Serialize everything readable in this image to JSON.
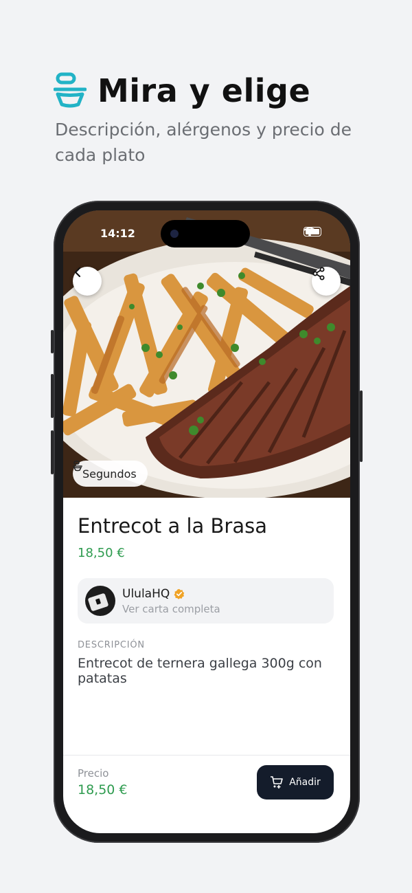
{
  "promo": {
    "title": "Mira y elige",
    "subtitle": "Descripción, alérgenos y precio de cada plato",
    "icon": "bowl-icon",
    "accent_color": "#22b3c6"
  },
  "status_bar": {
    "time": "14:12"
  },
  "hero": {
    "image_subject": "steak-with-fries-photo"
  },
  "category": {
    "label": "Segundos",
    "icon": "bowl-icon"
  },
  "dish": {
    "name": "Entrecot a la Brasa",
    "price": "18,50 €"
  },
  "vendor": {
    "name": "UlulaHQ",
    "link_label": "Ver carta completa",
    "verified_color": "#f0a326"
  },
  "description": {
    "label": "DESCRIPCIÓN",
    "text": "Entrecot de ternera gallega 300g con patatas"
  },
  "footer": {
    "price_label": "Precio",
    "price_value": "18,50 €",
    "add_label": "Añadir"
  },
  "colors": {
    "price_green": "#2e9b4f",
    "button_dark": "#141c2b"
  }
}
